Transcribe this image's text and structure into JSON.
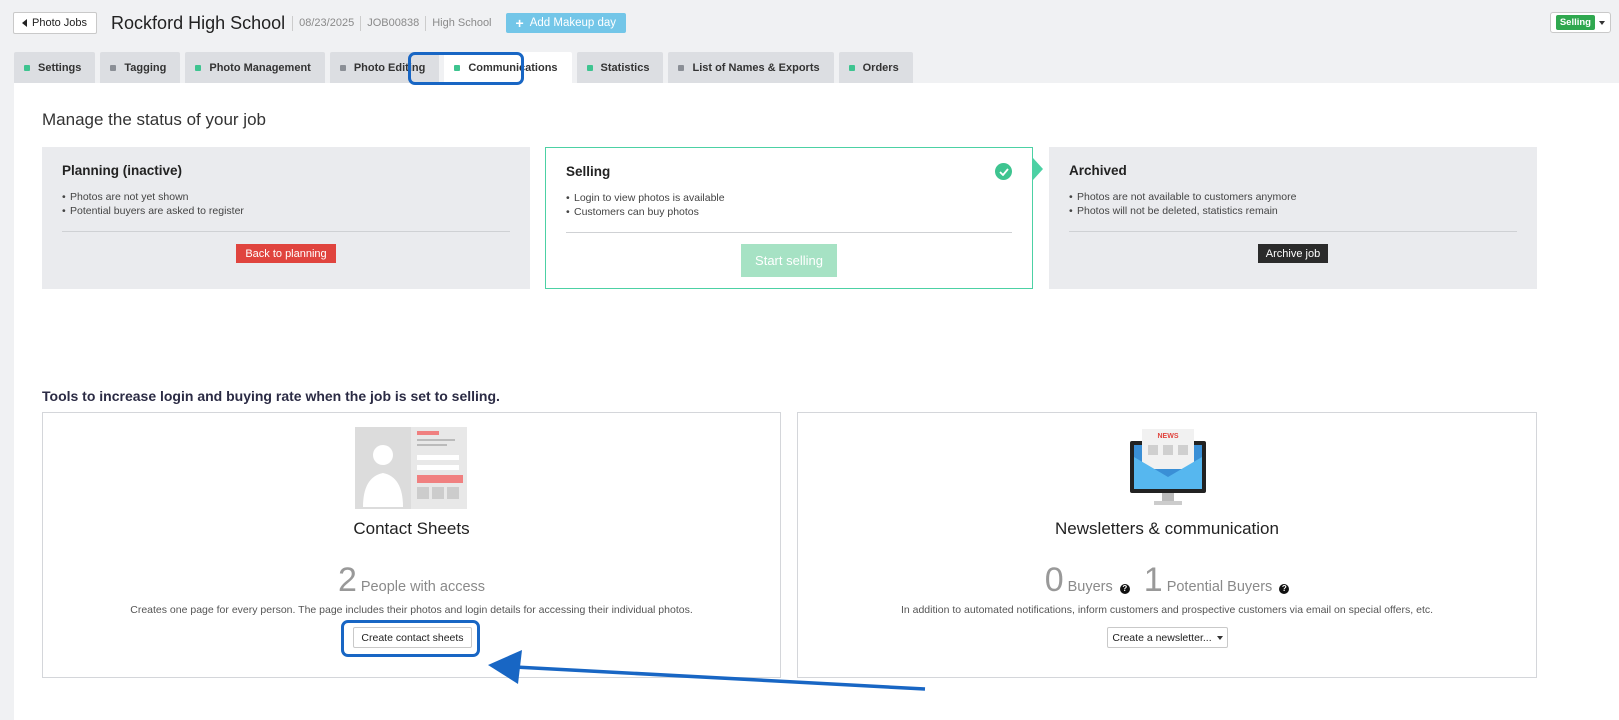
{
  "header": {
    "back_label": "Photo Jobs",
    "job_title": "Rockford High School",
    "date": "08/23/2025",
    "job_id": "JOB00838",
    "job_type": "High School",
    "add_makeup_label": "Add Makeup day",
    "status_value": "Selling"
  },
  "tabs": [
    {
      "label": "Settings",
      "dot": "green"
    },
    {
      "label": "Tagging",
      "dot": "gray"
    },
    {
      "label": "Photo Management",
      "dot": "green"
    },
    {
      "label": "Photo Editing",
      "dot": "gray"
    },
    {
      "label": "Communications",
      "dot": "green",
      "active": true
    },
    {
      "label": "Statistics",
      "dot": "green"
    },
    {
      "label": "List of Names & Exports",
      "dot": "gray"
    },
    {
      "label": "Orders",
      "dot": "green"
    }
  ],
  "status_section": {
    "title": "Manage the status of your job",
    "planning": {
      "title": "Planning (inactive)",
      "bullets": [
        "Photos are not yet shown",
        "Potential buyers are asked to register"
      ],
      "button": "Back to planning"
    },
    "selling": {
      "title": "Selling",
      "bullets": [
        "Login to view photos is available",
        "Customers can buy photos"
      ],
      "button": "Start selling"
    },
    "archived": {
      "title": "Archived",
      "bullets": [
        "Photos are not available to customers anymore",
        "Photos will not be deleted, statistics remain"
      ],
      "button": "Archive job"
    }
  },
  "tools": {
    "title": "Tools to increase login and buying rate when the job is set to selling.",
    "contact_sheets": {
      "name": "Contact Sheets",
      "count": "2",
      "count_label": "People with access",
      "description": "Creates one page for every person. The page includes their photos and login details for accessing their individual photos.",
      "button": "Create contact sheets"
    },
    "newsletters": {
      "name": "Newsletters & communication",
      "buyers_count": "0",
      "buyers_label": "Buyers",
      "potential_count": "1",
      "potential_label": "Potential Buyers",
      "description": "In addition to automated notifications, inform customers and prospective customers via email on special offers, etc.",
      "button": "Create a newsletter...",
      "news_text": "NEWS"
    }
  },
  "colors": {
    "accent_green": "#3ec490",
    "danger_red": "#e0443e",
    "annotation_blue": "#1866c4",
    "makeup_blue": "#73c6e8"
  }
}
